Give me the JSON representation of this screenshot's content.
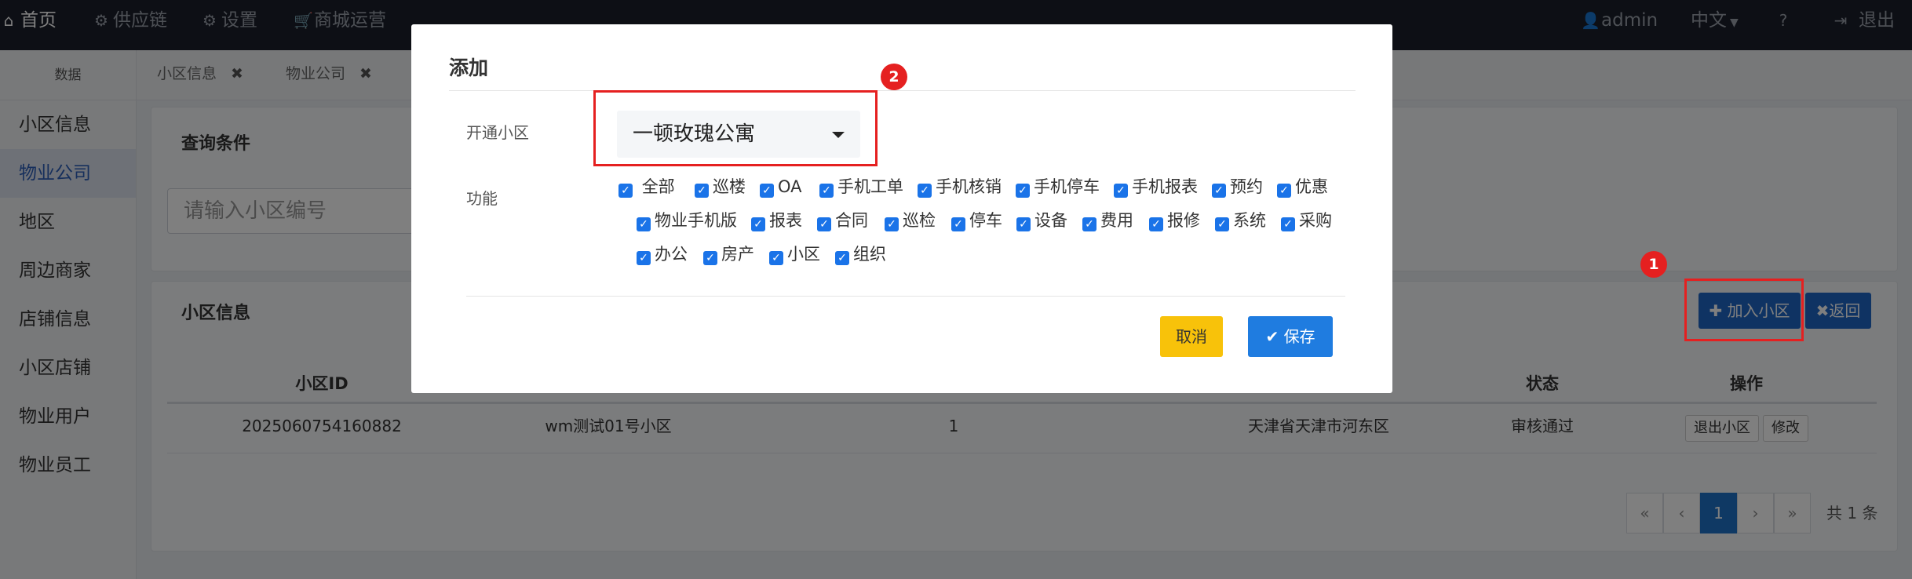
{
  "topnav": {
    "home": "首页",
    "supply_chain": "供应链",
    "settings": "设置",
    "mall_ops": "商城运营",
    "user": "admin",
    "language": "中文",
    "logout": "退出"
  },
  "sidebar": {
    "head": "数据",
    "items": [
      {
        "label": "小区信息"
      },
      {
        "label": "物业公司"
      },
      {
        "label": "地区"
      },
      {
        "label": "周边商家"
      },
      {
        "label": "店铺信息"
      },
      {
        "label": "小区店铺"
      },
      {
        "label": "物业用户"
      },
      {
        "label": "物业员工"
      }
    ]
  },
  "tabs": [
    {
      "label": "小区信息"
    },
    {
      "label": "物业公司"
    }
  ],
  "query_panel": {
    "title": "查询条件",
    "search_placeholder": "请输入小区编号"
  },
  "list_panel": {
    "title": "小区信息",
    "add_button": "加入小区",
    "back_button": "返回",
    "columns": [
      "小区ID",
      "状态",
      "操作"
    ],
    "rows": [
      {
        "id": "2025060754160882",
        "name": "wm测试01号小区",
        "count": "1",
        "region": "天津省天津市河东区",
        "status": "审核通过",
        "actions": [
          "退出小区",
          "修改"
        ]
      }
    ]
  },
  "pagination": {
    "first": "«",
    "prev": "‹",
    "current": "1",
    "next": "›",
    "last": "»",
    "total": "共 1 条"
  },
  "modal": {
    "title": "添加",
    "community_label": "开通小区",
    "community_value": "一顿玫瑰公寓",
    "function_label": "功能",
    "functions": [
      {
        "label": "全部"
      },
      {
        "label": "巡楼"
      },
      {
        "label": "OA"
      },
      {
        "label": "手机工单"
      },
      {
        "label": "手机核销"
      },
      {
        "label": "手机停车"
      },
      {
        "label": "手机报表"
      },
      {
        "label": "预约"
      },
      {
        "label": "优惠"
      },
      {
        "label": "物业手机版"
      },
      {
        "label": "报表"
      },
      {
        "label": "合同"
      },
      {
        "label": "巡检"
      },
      {
        "label": "停车"
      },
      {
        "label": "设备"
      },
      {
        "label": "费用"
      },
      {
        "label": "报修"
      },
      {
        "label": "系统"
      },
      {
        "label": "采购"
      },
      {
        "label": "办公"
      },
      {
        "label": "房产"
      },
      {
        "label": "小区"
      },
      {
        "label": "组织"
      }
    ],
    "cancel": "取消",
    "save": "保存"
  },
  "annotations": {
    "badge1": "1",
    "badge2": "2"
  },
  "colors": {
    "nav_bg": "#1b1f2b",
    "primary": "#1f66c6",
    "save": "#1f7ce0",
    "cancel": "#f8c20a",
    "annotation": "#e52020"
  }
}
